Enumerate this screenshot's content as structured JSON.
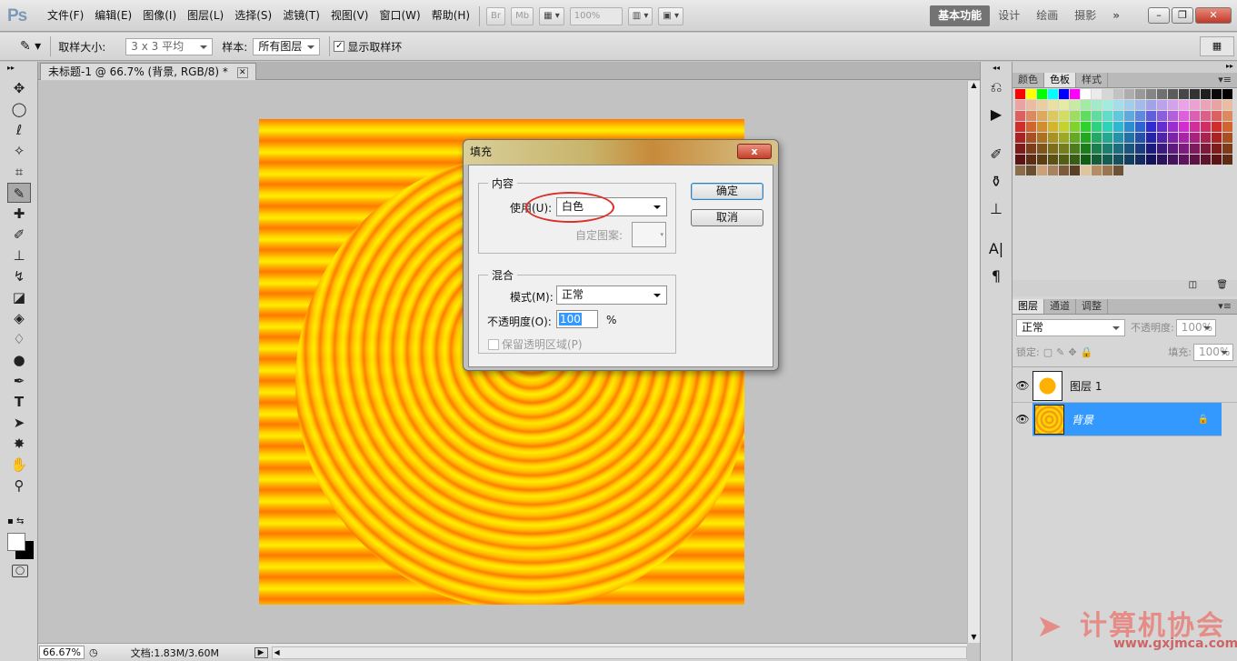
{
  "app": {
    "logo": "Ps"
  },
  "menu": [
    "文件(F)",
    "编辑(E)",
    "图像(I)",
    "图层(L)",
    "选择(S)",
    "滤镜(T)",
    "视图(V)",
    "窗口(W)",
    "帮助(H)"
  ],
  "top_buttons": {
    "bridge": "Br",
    "minibridge": "Mb",
    "zoom": "100%"
  },
  "workspaces": [
    "基本功能",
    "设计",
    "绘画",
    "摄影"
  ],
  "options": {
    "sample_size_label": "取样大小:",
    "sample_size_value": "3 x 3 平均",
    "sample_label": "样本:",
    "sample_value": "所有图层",
    "show_ring_label": "显示取样环",
    "show_ring_checked": true
  },
  "document": {
    "tab_title": "未标题-1 @ 66.7% (背景, RGB/8) *",
    "zoom": "66.67%",
    "doc_info": "文档:1.83M/3.60M"
  },
  "dialog": {
    "title": "填充",
    "close": "x",
    "content_legend": "内容",
    "use_label": "使用(U):",
    "use_value": "白色",
    "custom_pattern_label": "自定图案:",
    "blend_legend": "混合",
    "mode_label": "模式(M):",
    "mode_value": "正常",
    "opacity_label": "不透明度(O):",
    "opacity_value": "100",
    "opacity_unit": "%",
    "preserve_label": "保留透明区域(P)",
    "ok": "确定",
    "cancel": "取消"
  },
  "swatch_panel": {
    "tabs": [
      "颜色",
      "色板",
      "样式"
    ],
    "active": "色板"
  },
  "layers_panel": {
    "tabs": [
      "图层",
      "通道",
      "调整"
    ],
    "blend_mode": "正常",
    "opacity_label": "不透明度:",
    "opacity": "100%",
    "lock_label": "锁定:",
    "fill_label": "填充:",
    "fill": "100%",
    "layers": [
      {
        "name": "图层 1",
        "selected": false
      },
      {
        "name": "背景",
        "selected": true
      }
    ]
  },
  "watermark": {
    "text": "计算机协会",
    "url": "www.gxjmca.com"
  },
  "colors": {
    "accent": "#3399ff",
    "close_red": "#c0392b",
    "highlight_circle": "#d9302a"
  }
}
